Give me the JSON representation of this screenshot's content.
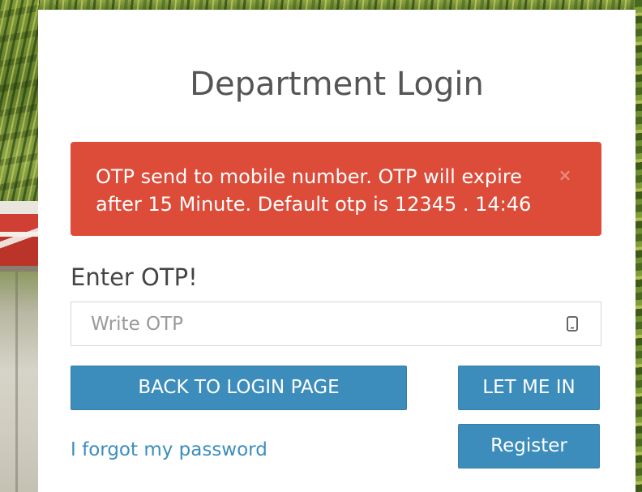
{
  "page": {
    "title": "Department Login"
  },
  "alert": {
    "message": "OTP send to mobile number. OTP will expire after 15 Minute. Default otp is 12345 . 14:46",
    "close_label": "×",
    "close_icon": "close-icon"
  },
  "otp": {
    "label": "Enter OTP!",
    "placeholder": "Write OTP",
    "value": "",
    "icon": "mobile-phone-icon"
  },
  "buttons": {
    "back_label": "BACK TO LOGIN PAGE",
    "login_label": "LET ME IN",
    "register_label": "Register"
  },
  "links": {
    "forgot_password": "I forgot my password"
  },
  "colors": {
    "primary": "#3c8dbc",
    "danger": "#dd4b39"
  }
}
